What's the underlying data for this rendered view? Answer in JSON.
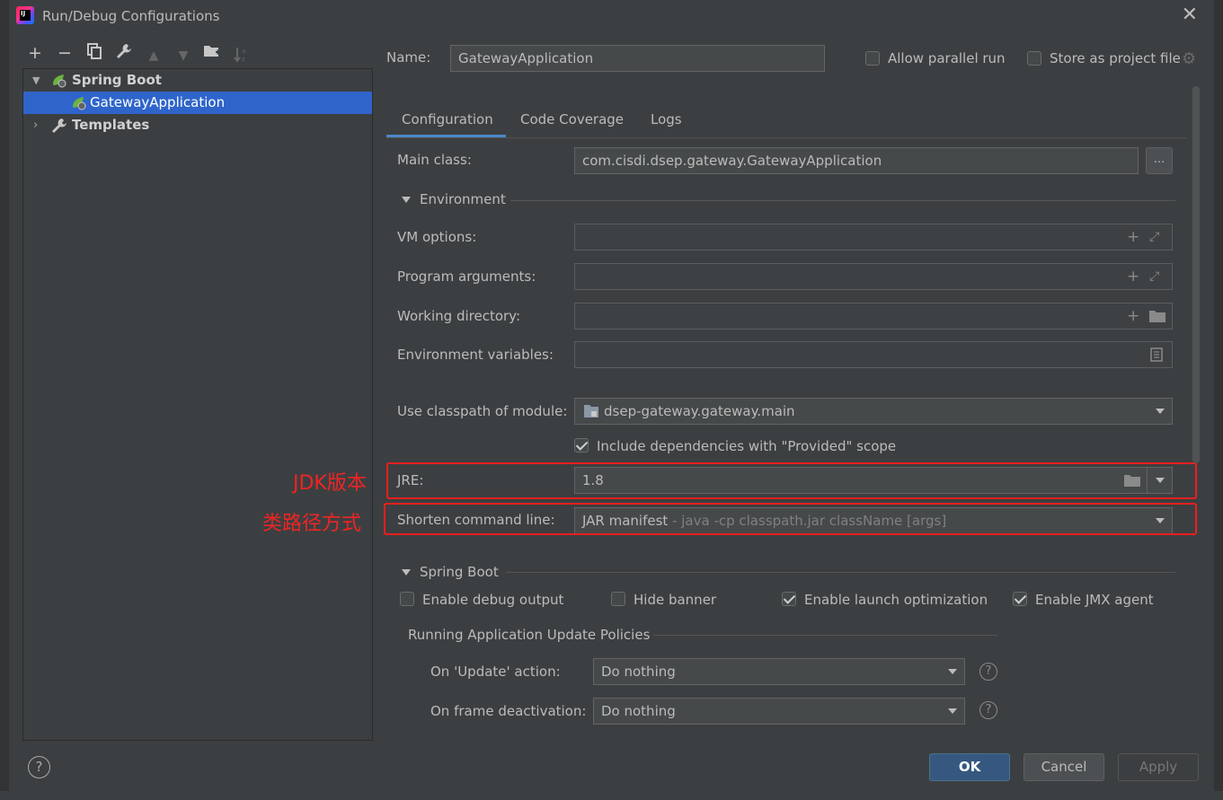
{
  "window": {
    "title": "Run/Debug Configurations",
    "logo_text": "IJ"
  },
  "toolbar": {
    "add": "+",
    "remove": "−",
    "copy": "⧉",
    "wrench": "🔧",
    "up": "▲",
    "down": "▼",
    "folder": "📁",
    "sort": "↓a z"
  },
  "tree": {
    "spring_boot": "Spring Boot",
    "gateway_app": "GatewayApplication",
    "templates": "Templates"
  },
  "header": {
    "name_label": "Name:",
    "name_value": "GatewayApplication",
    "allow_parallel": "Allow parallel run",
    "store_as_project": "Store as project file"
  },
  "tabs": [
    "Configuration",
    "Code Coverage",
    "Logs"
  ],
  "form": {
    "main_class_label": "Main class:",
    "main_class_value": "com.cisdi.dsep.gateway.GatewayApplication",
    "browse": "...",
    "environment_section": "Environment",
    "vm_options_label": "VM options:",
    "program_args_label": "Program arguments:",
    "working_dir_label": "Working directory:",
    "env_vars_label": "Environment variables:",
    "classpath_label": "Use classpath of module:",
    "classpath_value": "dsep-gateway.gateway.main",
    "include_deps": "Include dependencies with \"Provided\" scope",
    "jre_label": "JRE:",
    "jre_value": "1.8",
    "shorten_label": "Shorten command line:",
    "shorten_value": "JAR manifest",
    "shorten_hint": " - java -cp classpath.jar className [args]"
  },
  "spring_boot_section": {
    "title": "Spring Boot",
    "enable_debug": "Enable debug output",
    "hide_banner": "Hide banner",
    "enable_launch": "Enable launch optimization",
    "enable_jmx": "Enable JMX agent",
    "policies_title": "Running Application Update Policies",
    "on_update_label": "On 'Update' action:",
    "on_update_value": "Do nothing",
    "on_frame_label": "On frame deactivation:",
    "on_frame_value": "Do nothing"
  },
  "checkbox_states": {
    "allow_parallel": false,
    "store_as_project": false,
    "include_deps": true,
    "enable_debug": false,
    "hide_banner": false,
    "enable_launch": true,
    "enable_jmx": true
  },
  "annotations": {
    "jdk_version": "JDK版本",
    "classpath_mode": "类路径方式"
  },
  "buttons": {
    "help": "?",
    "ok": "OK",
    "cancel": "Cancel",
    "apply": "Apply"
  },
  "colors": {
    "annotation_red": "#f01e1e",
    "selection_blue": "#2f65ca",
    "primary_button": "#365880"
  }
}
